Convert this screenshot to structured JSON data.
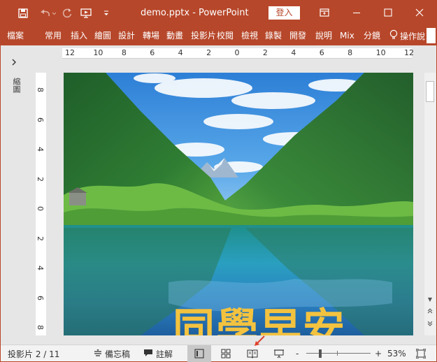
{
  "window": {
    "title": "demo.pptx  -  PowerPoint",
    "sign_in": "登入"
  },
  "ribbon": {
    "tabs": [
      "檔案",
      "常用",
      "插入",
      "繪圖",
      "設計",
      "轉場",
      "動畫",
      "投影片",
      "校閱",
      "檢視",
      "錄製",
      "開發",
      "說明",
      "Mix",
      "分鏡"
    ],
    "tell_me": "操作說"
  },
  "left_pane": {
    "label": "縮圖"
  },
  "ruler": {
    "horizontal": [
      "12",
      "10",
      "8",
      "6",
      "4",
      "2",
      "0",
      "2",
      "4",
      "6",
      "8",
      "10",
      "12"
    ],
    "vertical": [
      "8",
      "6",
      "4",
      "2",
      "0",
      "2",
      "4",
      "6",
      "8"
    ]
  },
  "slide": {
    "title": "同學早安"
  },
  "status": {
    "slide_indicator": "投影片 2 / 11",
    "notes": "備忘稿",
    "comments": "註解",
    "zoom_minus": "-",
    "zoom_plus": "+",
    "zoom_level": "53%",
    "zoom_fraction": 0.53
  },
  "colors": {
    "accent": "#b7472a",
    "title_text": "#f3c23f",
    "annotation_arrow": "#e0412c"
  },
  "icons": {
    "save": "save-icon",
    "undo": "undo-icon",
    "redo": "redo-icon",
    "present": "present-from-start-icon",
    "customize": "customize-qat-icon",
    "ribbon_display": "ribbon-display-options-icon",
    "minimize": "minimize-icon",
    "maximize": "maximize-icon",
    "close": "close-icon",
    "lightbulb": "lightbulb-icon",
    "notes": "notes-icon",
    "comments": "comment-icon",
    "normal_view": "normal-view-icon",
    "sorter_view": "slide-sorter-icon",
    "reading_view": "reading-view-icon",
    "slideshow_view": "slideshow-view-icon",
    "fit_window": "fit-to-window-icon"
  }
}
